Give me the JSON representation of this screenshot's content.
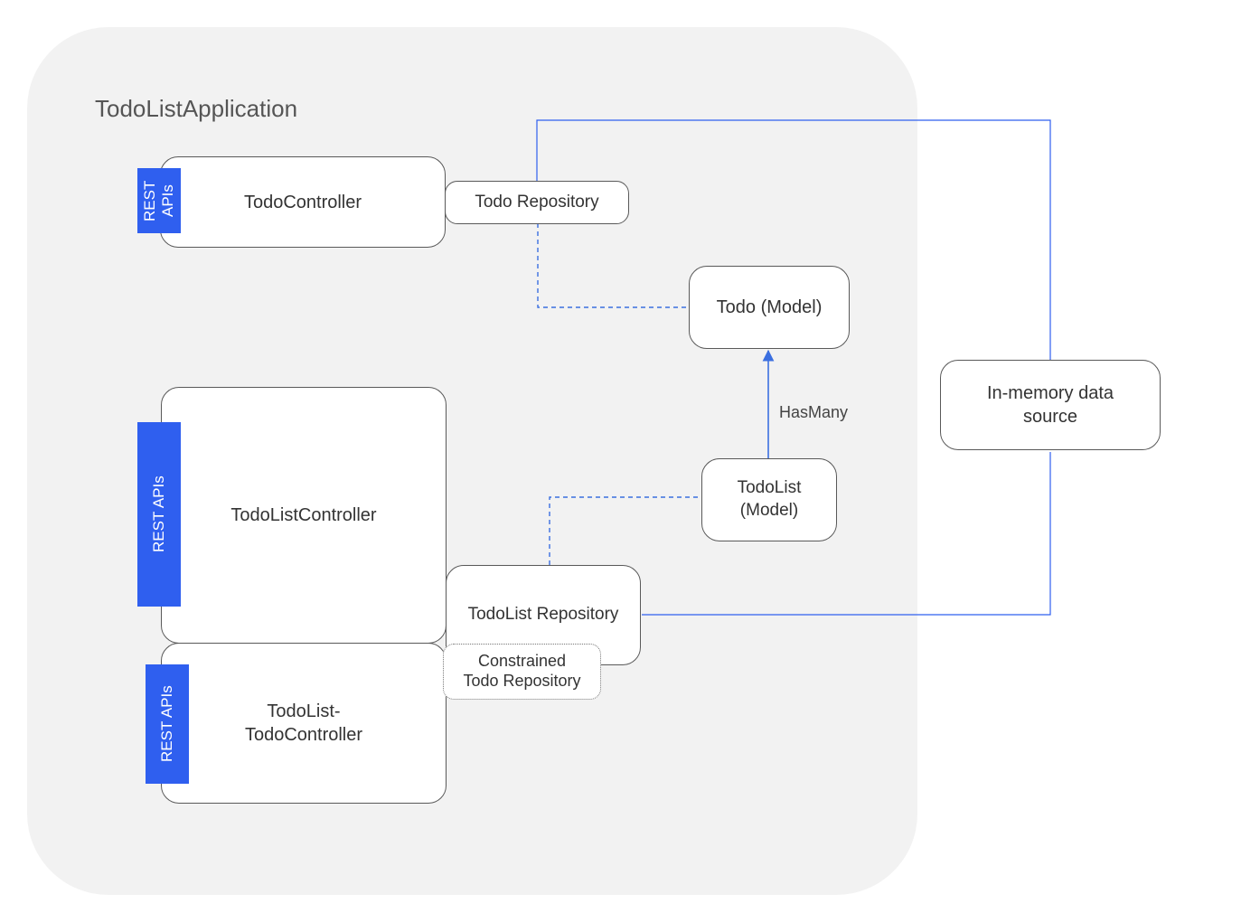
{
  "title": "TodoListApplication",
  "tags": {
    "rest_apis": "REST\nAPIs",
    "rest_apis2": "REST APIs",
    "rest_apis3": "REST APIs"
  },
  "nodes": {
    "todo_controller": "TodoController",
    "todo_repository": "Todo Repository",
    "todo_model": "Todo (Model)",
    "todolist_controller": "TodoListController",
    "todolist_repository": "TodoList Repository",
    "constrained_repo": "Constrained\nTodo Repository",
    "todolist_todo_controller": "TodoList-\nTodoController",
    "todolist_model": "TodoList\n(Model)",
    "datasource": "In-memory data\nsource"
  },
  "edges": {
    "hasmany": "HasMany"
  },
  "colors": {
    "bg": "#f2f2f2",
    "accent": "#2f5fef",
    "solid_edge": "#2f5fef",
    "dashed_edge": "#3b6fe0"
  }
}
